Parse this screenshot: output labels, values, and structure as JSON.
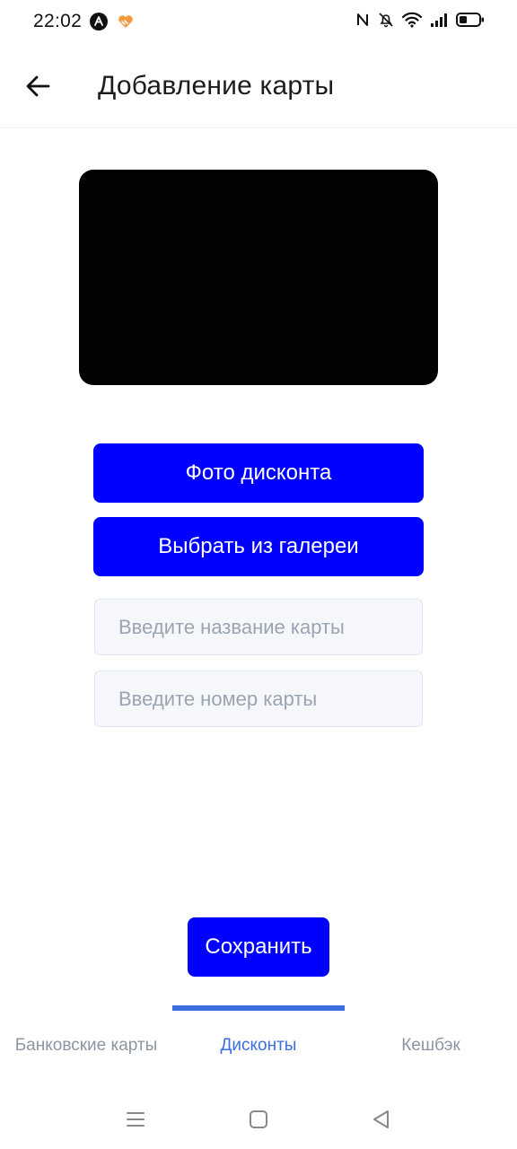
{
  "status_bar": {
    "time": "22:02",
    "left_icons": [
      "app-a-icon",
      "heart-app-icon"
    ],
    "right_icons": [
      "nfc-icon",
      "bell-off-icon",
      "wifi-icon",
      "signal-icon",
      "battery-icon"
    ]
  },
  "header": {
    "back_icon": "arrow-left-icon",
    "title": "Добавление карты"
  },
  "camera_preview": {
    "background": "#020202"
  },
  "buttons": {
    "photo_label": "Фото дисконта",
    "gallery_label": "Выбрать из галереи",
    "save_label": "Сохранить"
  },
  "inputs": {
    "card_name": {
      "value": "",
      "placeholder": "Введите название карты"
    },
    "card_number": {
      "value": "",
      "placeholder": "Введите номер карты"
    }
  },
  "tabs": [
    {
      "label": "Банковские карты",
      "active": false
    },
    {
      "label": "Дисконты",
      "active": true
    },
    {
      "label": "Кешбэк",
      "active": false
    }
  ],
  "system_nav": [
    "menu-icon",
    "home-icon",
    "back-triangle-icon"
  ],
  "colors": {
    "primary": "#0000fe",
    "active_tab": "#3b6fe0",
    "inactive_tab": "#8c95a3",
    "input_bg": "#f5f7fb"
  }
}
